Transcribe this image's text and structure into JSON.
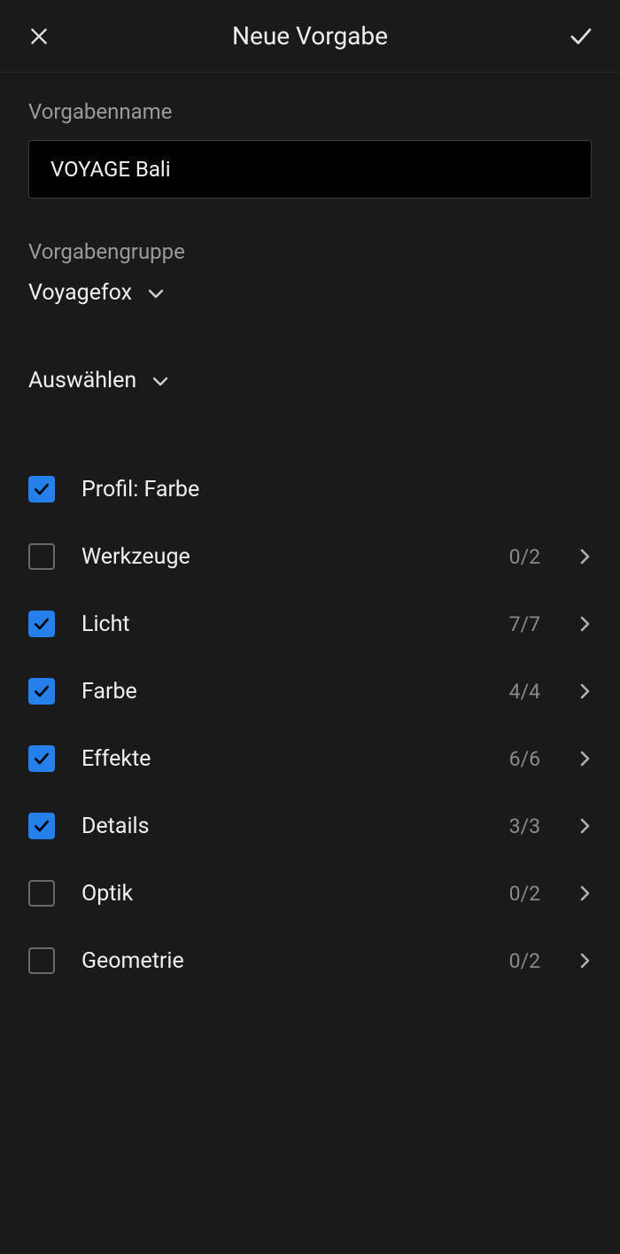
{
  "header": {
    "title": "Neue Vorgabe"
  },
  "form": {
    "name_label": "Vorgabenname",
    "name_value": "VOYAGE Bali",
    "group_label": "Vorgabengruppe",
    "group_value": "Voyagefox",
    "select_label": "Auswählen"
  },
  "options": [
    {
      "label": "Profil: Farbe",
      "checked": true,
      "count": "",
      "expandable": false
    },
    {
      "label": "Werkzeuge",
      "checked": false,
      "count": "0/2",
      "expandable": true
    },
    {
      "label": "Licht",
      "checked": true,
      "count": "7/7",
      "expandable": true
    },
    {
      "label": "Farbe",
      "checked": true,
      "count": "4/4",
      "expandable": true
    },
    {
      "label": "Effekte",
      "checked": true,
      "count": "6/6",
      "expandable": true
    },
    {
      "label": "Details",
      "checked": true,
      "count": "3/3",
      "expandable": true
    },
    {
      "label": "Optik",
      "checked": false,
      "count": "0/2",
      "expandable": true
    },
    {
      "label": "Geometrie",
      "checked": false,
      "count": "0/2",
      "expandable": true
    }
  ]
}
